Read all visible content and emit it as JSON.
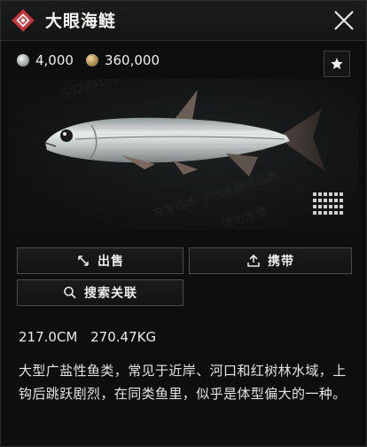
{
  "header": {
    "title": "大眼海鲢",
    "badge_icon": "red-diamond-icon",
    "close_icon": "close-icon"
  },
  "prices": {
    "silver": {
      "icon": "silver-coin-icon",
      "amount": "4,000"
    },
    "gold": {
      "icon": "gold-coin-icon",
      "amount": "360,000"
    }
  },
  "favorite": {
    "icon": "star-icon"
  },
  "watermark": {
    "line1": "开发版本 不代表最终品质",
    "line2": "请勿传播",
    "id": "5823915844"
  },
  "actions": {
    "sell_label": "出售",
    "carry_label": "携带",
    "search_label": "搜索关联"
  },
  "stats": {
    "length": "217.0CM",
    "weight": "270.47KG"
  },
  "description": "大型广盐性鱼类，常见于近岸、河口和红树林水域，上钩后跳跃剧烈，在同类鱼里，似乎是体型偏大的一种。",
  "colors": {
    "accent": "#c8343a",
    "background": "#0d0e0e",
    "border": "#4a4e4d"
  }
}
